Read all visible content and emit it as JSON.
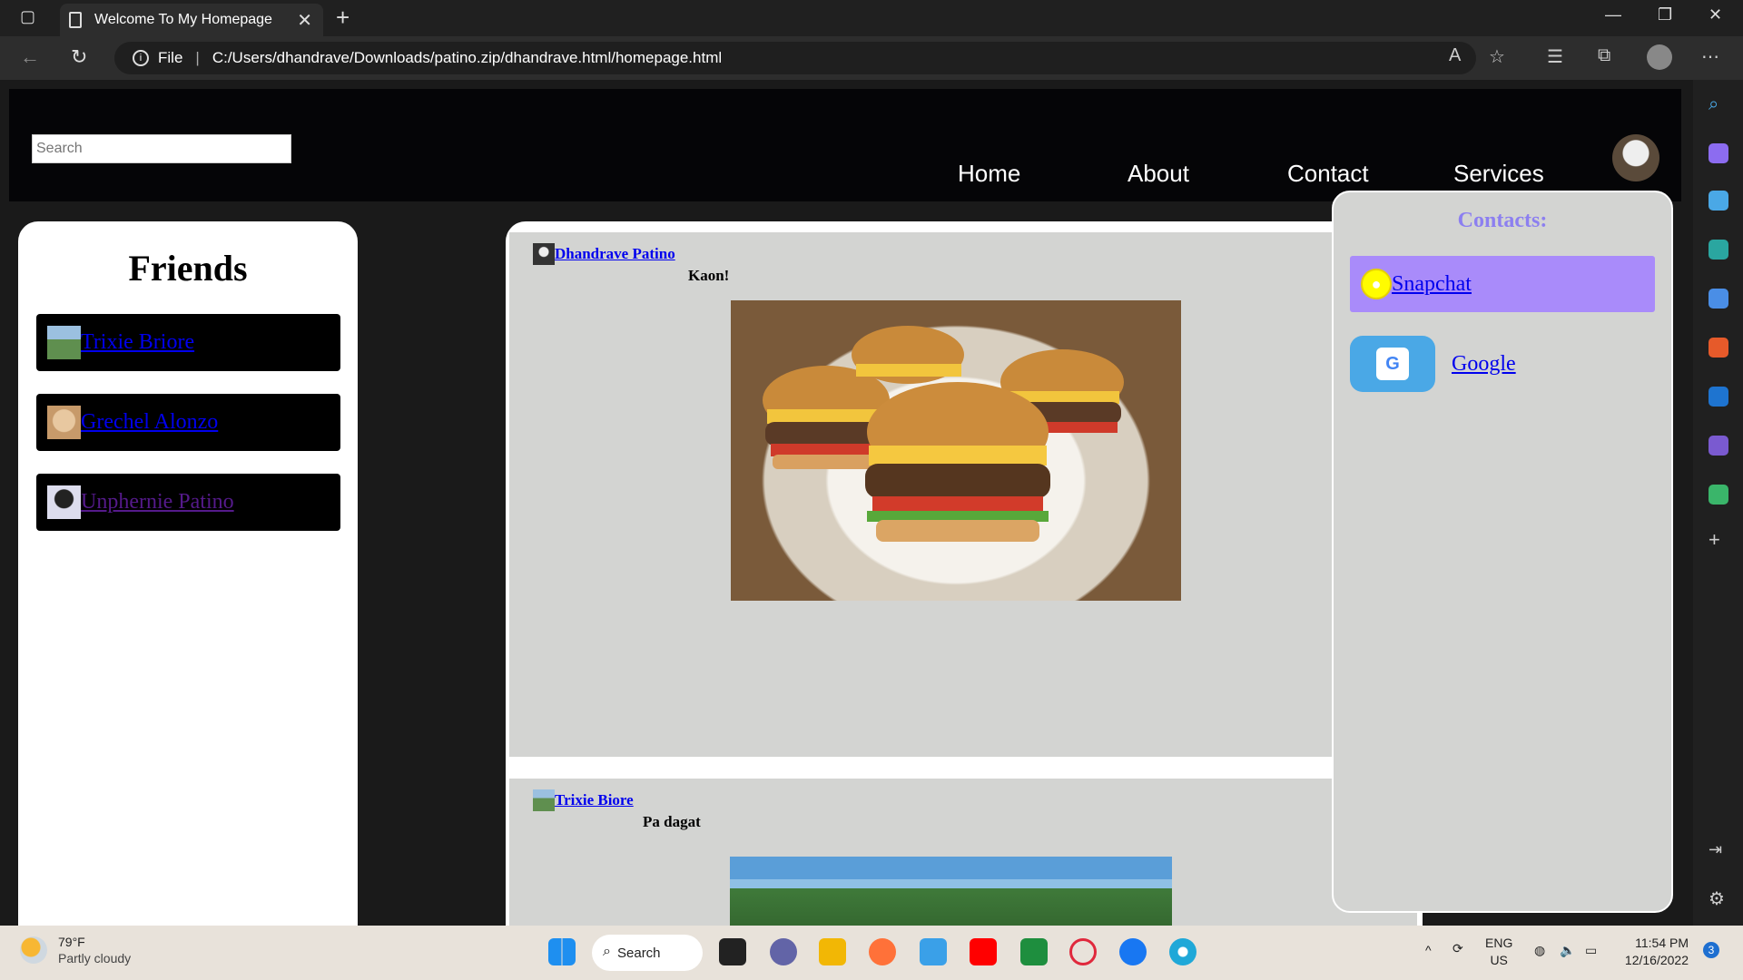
{
  "browser": {
    "tab_title": "Welcome To My Homepage",
    "url_scheme": "File",
    "url": "C:/Users/dhandrave/Downloads/patino.zip/dhandrave.html/homepage.html"
  },
  "page": {
    "search": {
      "placeholder": "Search"
    },
    "nav": {
      "home": "Home",
      "about": "About",
      "contact": "Contact",
      "services": "Services"
    },
    "friends": {
      "title": "Friends",
      "items": [
        {
          "name": "Trixie Briore"
        },
        {
          "name": "Grechel Alonzo"
        },
        {
          "name": "Unphernie Patino"
        }
      ]
    },
    "posts": [
      {
        "author": "Dhandrave Patino",
        "caption": "Kaon!"
      },
      {
        "author": "Trixie Biore",
        "caption": "Pa dagat"
      }
    ],
    "contacts": {
      "title": "Contacts:",
      "items": [
        {
          "label": "Snapchat"
        },
        {
          "label": "Google"
        }
      ]
    }
  },
  "taskbar": {
    "temperature": "79°F",
    "weather": "Partly cloudy",
    "search_label": "Search",
    "lang": "ENG",
    "region": "US",
    "time": "11:54 PM",
    "date": "12/16/2022",
    "notifications": "3"
  },
  "colors": {
    "header_bg": "#050507",
    "panel_gray": "#d3d4d2",
    "contacts_title": "#8c7ff0",
    "snapchat_bg": "#a98bfa",
    "google_bg": "#4aa8e6",
    "link_blue": "#0000ee",
    "visited_purple": "#551a8b"
  }
}
